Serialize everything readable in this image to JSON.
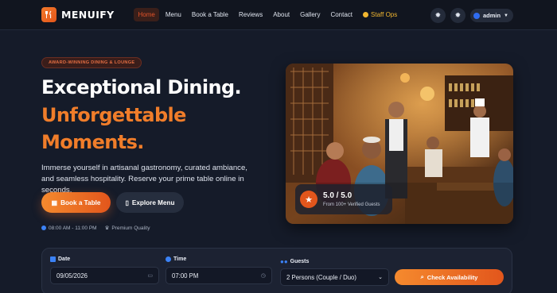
{
  "nav": {
    "brand": "MENUIFY",
    "items": [
      {
        "label": "Home",
        "active": true
      },
      {
        "label": "Menu"
      },
      {
        "label": "Book a Table"
      },
      {
        "label": "Reviews"
      },
      {
        "label": "About"
      },
      {
        "label": "Gallery"
      },
      {
        "label": "Contact"
      }
    ],
    "staff_label": "Staff Ops",
    "user_label": "admin"
  },
  "hero": {
    "badge": "AWARD-WINNING DINING & LOUNGE",
    "title_line1": "Exceptional Dining.",
    "title_line2": "Unforgettable",
    "title_line3": "Moments.",
    "description": "Immerse yourself in artisanal gastronomy, curated ambiance, and seamless hospitality. Reserve your prime table online in seconds.",
    "primary_button": "Book a Table",
    "secondary_button": "Explore Menu",
    "hours": "08:00 AM - 11:00 PM",
    "quality": "Premium Quality"
  },
  "rating": {
    "value": "5.0 / 5.0",
    "subtitle": "From 100+ Verified Guests"
  },
  "booking": {
    "date_label": "Date",
    "date_value": "09/05/2026",
    "time_label": "Time",
    "time_value": "07:00 PM",
    "guests_label": "Guests",
    "guests_value": "2 Persons (Couple / Duo)",
    "submit_label": "Check Availability"
  },
  "colors": {
    "accent": "#f07d2a",
    "accent_dark": "#e2561c",
    "background": "#151b29",
    "staff": "#f1b630"
  }
}
